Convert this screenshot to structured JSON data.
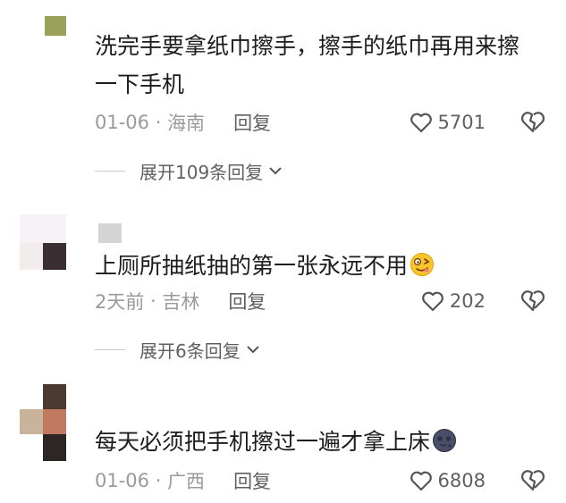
{
  "comments": [
    {
      "text": "洗完手要拿纸巾擦手，擦手的纸巾再用来擦一下手机",
      "date": "01-06",
      "location": "海南",
      "reply_label": "回复",
      "likes": "5701",
      "expand_label": "展开109条回复",
      "avatar_color": "#9aa15a"
    },
    {
      "text": "上厕所抽纸抽的第一张永远不用",
      "emoji": "drooling-face-emoji",
      "date": "2天前",
      "location": "吉林",
      "reply_label": "回复",
      "likes": "202",
      "expand_label": "展开6条回复",
      "avatar_color": "#3b2e33"
    },
    {
      "text": "每天必须把手机擦过一遍才拿上床",
      "emoji": "new-moon-face-emoji",
      "date": "01-06",
      "location": "广西",
      "reply_label": "回复",
      "likes": "6808",
      "avatar_color": "#5a4236"
    }
  ],
  "icons": {
    "like": "heart-outline-icon",
    "dislike": "broken-heart-outline-icon",
    "expand": "chevron-down-icon"
  }
}
